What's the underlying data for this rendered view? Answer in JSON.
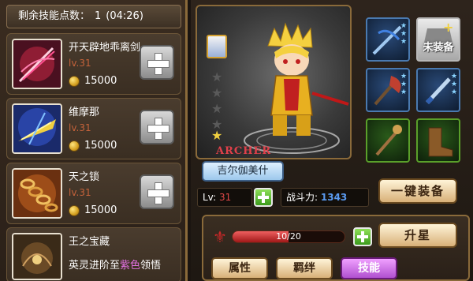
{
  "header": {
    "points_label": "剩余技能点数：",
    "points_value": "1",
    "timer": "(04:26)"
  },
  "skills": [
    {
      "name": "开天辟地乖离剑",
      "level": "lv.31",
      "cost": "15000",
      "icon": "red-sword-icon"
    },
    {
      "name": "维摩那",
      "level": "lv.31",
      "cost": "15000",
      "icon": "golden-ship-icon"
    },
    {
      "name": "天之锁",
      "level": "lv.31",
      "cost": "15000",
      "icon": "chain-icon"
    }
  ],
  "treasure": {
    "name": "王之宝藏",
    "desc_prefix": "英灵进阶至",
    "desc_highlight": "紫色",
    "desc_suffix": "领悟"
  },
  "hero": {
    "class_label": "ARCHER",
    "name": "吉尔伽美什",
    "lv_label": "Lv:",
    "lv_value": "31",
    "power_label": "战斗力:",
    "power_value": "1343",
    "stars_total": 5,
    "stars_lit": 1
  },
  "equipment": [
    {
      "slot": "weapon",
      "icon": "crossbow-icon",
      "stars": 3,
      "color": "blue"
    },
    {
      "slot": "armor",
      "empty": true,
      "label": "未装备"
    },
    {
      "slot": "offhand",
      "icon": "axe-icon",
      "stars": 3,
      "color": "blue"
    },
    {
      "slot": "accessory",
      "icon": "dagger-icon",
      "stars": 3,
      "color": "blue"
    },
    {
      "slot": "staff",
      "icon": "staff-icon",
      "stars": 0,
      "color": "green"
    },
    {
      "slot": "boots",
      "icon": "boots-icon",
      "stars": 0,
      "color": "green"
    }
  ],
  "buttons": {
    "equip_all": "一键装备",
    "star_up": "升星",
    "tab_attr": "属性",
    "tab_bond": "羁绊",
    "tab_skill": "技能"
  },
  "progress": {
    "text": "10/20",
    "current": 10,
    "max": 20
  },
  "colors": {
    "accent_gold": "#d4a030",
    "level_red": "#c4623a",
    "power_blue": "#5a9af0",
    "highlight_purple": "#e070e0"
  }
}
